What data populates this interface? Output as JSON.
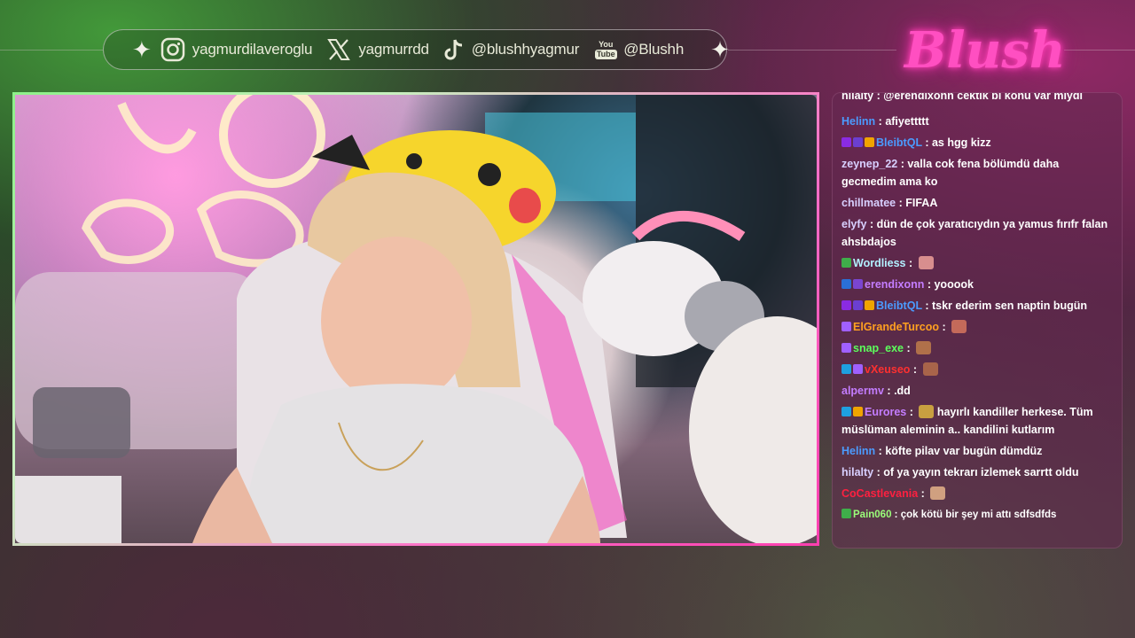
{
  "socials": [
    {
      "icon": "instagram-icon",
      "handle": "yagmurdilaveroglu"
    },
    {
      "icon": "x-twitter-icon",
      "handle": "yagmurrdd"
    },
    {
      "icon": "tiktok-icon",
      "handle": "@blushhyagmur"
    },
    {
      "icon": "youtube-icon",
      "handle": "@Blushh",
      "icon_text_top": "You",
      "icon_text_bottom": "Tube"
    }
  ],
  "logo_text": "Blush",
  "chat": {
    "cut_line": "hilalty : @erendixonn cektik bi konu var miydi",
    "messages": [
      {
        "user": "Helinn",
        "color": "#4b9bff",
        "text": "afiyettttt",
        "badges": []
      },
      {
        "user": "BleibtQL",
        "color": "#4b9bff",
        "text": "as hgg kizz",
        "badges": [
          "#8a2be2",
          "#6b3fd0",
          "#f0a400"
        ]
      },
      {
        "user": "zeynep_22",
        "color": "#d8d0ff",
        "text": "valla cok fena bölümdü daha gecmedim ama ko",
        "badges": []
      },
      {
        "user": "chillmatee",
        "color": "#d8d0ff",
        "text": "FIFAA",
        "badges": []
      },
      {
        "user": "elyfy",
        "color": "#d8d0ff",
        "text": "dün de çok yaratıcıydın ya yamus fırıfr falan ahsbdajos",
        "badges": []
      },
      {
        "user": "Wordliess",
        "color": "#b2f0ff",
        "text": "",
        "badges": [
          "#3fae4a"
        ],
        "emote": "#d88e8e"
      },
      {
        "user": "erendixonn",
        "color": "#c47dff",
        "text": "yooook",
        "badges": [
          "#2a6fd6",
          "#7a45d0"
        ]
      },
      {
        "user": "BleibtQL",
        "color": "#4b9bff",
        "text": "tskr ederim sen naptin bugün",
        "badges": [
          "#8a2be2",
          "#6b3fd0",
          "#f0a400"
        ]
      },
      {
        "user": "ElGrandeTurcoo",
        "color": "#ffa020",
        "text": "",
        "badges": [
          "#a060ff"
        ],
        "emote": "#c46a5a"
      },
      {
        "user": "snap_exe",
        "color": "#5cff5c",
        "text": "",
        "badges": [
          "#a060ff"
        ],
        "emote": "#b0704a"
      },
      {
        "user": "vXeuseo",
        "color": "#ff3030",
        "text": "",
        "badges": [
          "#1ea0e0",
          "#a060ff"
        ],
        "emote": "#a8644a"
      },
      {
        "user": "alpermv",
        "color": "#c47dff",
        "text": ".dd",
        "badges": []
      },
      {
        "user": "Eurores",
        "color": "#c47dff",
        "text": "hayırlı kandiller herkese. Tüm müslüman aleminin a.. kandilini kutlarım",
        "badges": [
          "#1ea0e0",
          "#f0a400"
        ],
        "emote_prefix": "#c8a040"
      },
      {
        "user": "Helinn",
        "color": "#4b9bff",
        "text": "köfte pilav var bugün dümdüz",
        "badges": []
      },
      {
        "user": "hilalty",
        "color": "#d8d0ff",
        "text": "of ya yayın tekrarı izlemek sarrtt oldu",
        "badges": []
      },
      {
        "user": "CoCastlevania",
        "color": "#ff2040",
        "text": "",
        "badges": [],
        "emote": "#d0a080"
      },
      {
        "user": "Pain060",
        "color": "#9bff7a",
        "text": "çok kötü bir şey mi attı sdfsdfds",
        "badges": [
          "#3fae4a"
        ],
        "small": true
      }
    ]
  }
}
